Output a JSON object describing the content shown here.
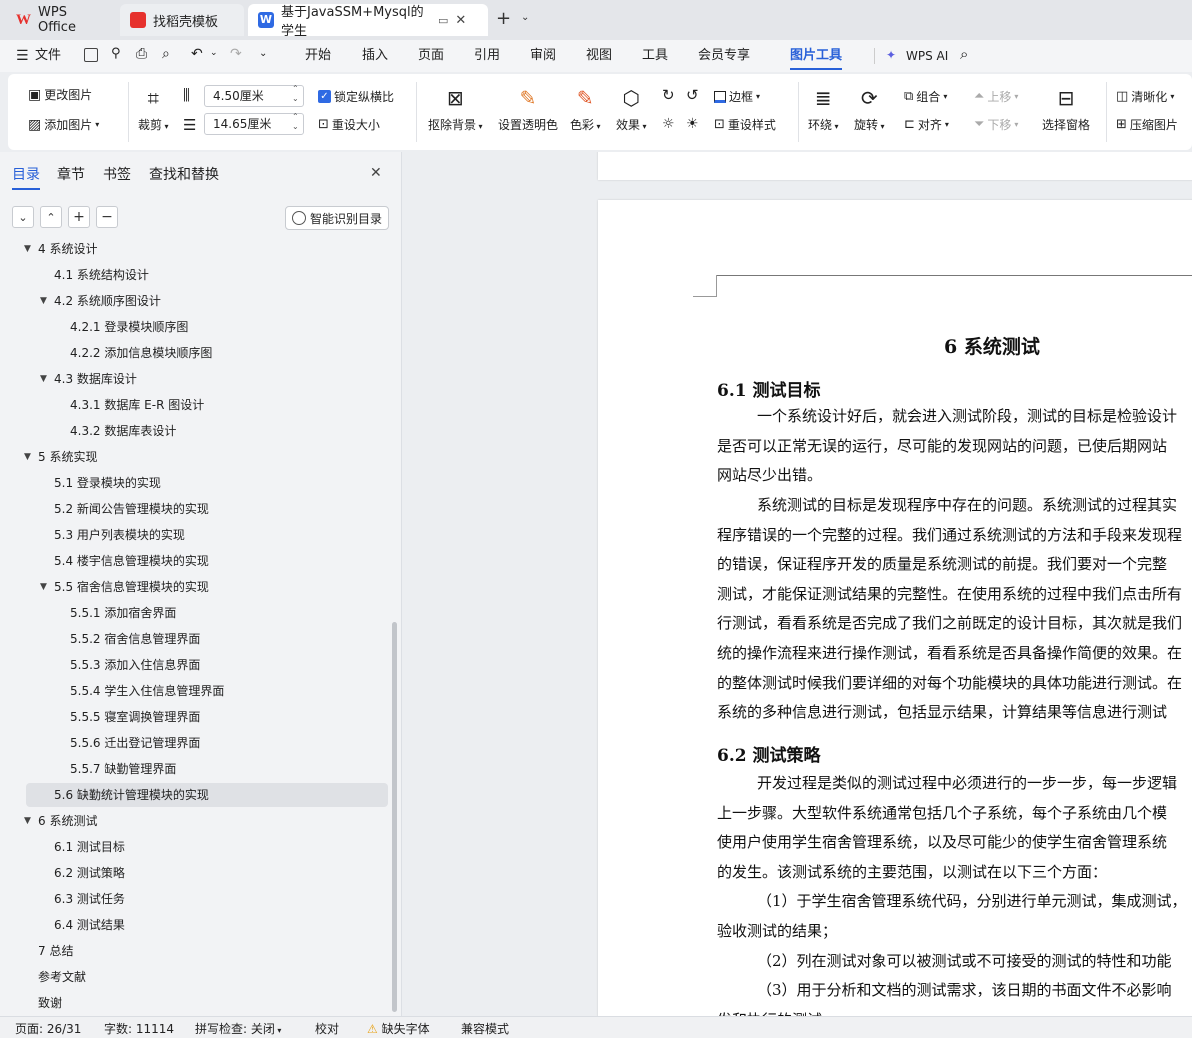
{
  "tabs": [
    {
      "label": "WPS Office"
    },
    {
      "label": "找稻壳模板"
    },
    {
      "label": "基于JavaSSM+Mysql的学生"
    }
  ],
  "menu": {
    "file": "文件",
    "items": [
      "开始",
      "插入",
      "页面",
      "引用",
      "审阅",
      "视图",
      "工具",
      "会员专享",
      "图片工具"
    ],
    "wps_ai": "WPS AI"
  },
  "ribbon": {
    "change_picture": "更改图片",
    "add_picture": "添加图片",
    "crop": "裁剪",
    "width_value": "4.50厘米",
    "height_value": "14.65厘米",
    "lock_ratio": "锁定纵横比",
    "resize": "重设大小",
    "remove_bg": "抠除背景",
    "set_transparent": "设置透明色",
    "color": "色彩",
    "effects": "效果",
    "border": "边框",
    "reset_style": "重设样式",
    "wrap": "环绕",
    "rotate": "旋转",
    "group": "组合",
    "align": "对齐",
    "move_up": "上移",
    "move_down": "下移",
    "select_pane": "选择窗格",
    "clarity": "清晰化",
    "compress": "压缩图片"
  },
  "panel": {
    "tabs": [
      "目录",
      "章节",
      "书签",
      "查找和替换"
    ],
    "smart_toc": "智能识别目录",
    "toc": [
      {
        "label": "4  系统设计",
        "level": 0,
        "arrow": true
      },
      {
        "label": "4.1  系统结构设计",
        "level": 1,
        "arrow": false
      },
      {
        "label": "4.2  系统顺序图设计",
        "level": 1,
        "arrow": true
      },
      {
        "label": "4.2.1 登录模块顺序图",
        "level": 2,
        "arrow": false
      },
      {
        "label": "4.2.2 添加信息模块顺序图",
        "level": 2,
        "arrow": false
      },
      {
        "label": "4.3  数据库设计",
        "level": 1,
        "arrow": true
      },
      {
        "label": "4.3.1 数据库 E-R 图设计",
        "level": 2,
        "arrow": false
      },
      {
        "label": "4.3.2 数据库表设计",
        "level": 2,
        "arrow": false
      },
      {
        "label": "5  系统实现",
        "level": 0,
        "arrow": true
      },
      {
        "label": "5.1  登录模块的实现",
        "level": 1,
        "arrow": false
      },
      {
        "label": "5.2  新闻公告管理模块的实现",
        "level": 1,
        "arrow": false
      },
      {
        "label": "5.3  用户列表模块的实现",
        "level": 1,
        "arrow": false
      },
      {
        "label": "5.4  楼宇信息管理模块的实现",
        "level": 1,
        "arrow": false
      },
      {
        "label": "5.5  宿舍信息管理模块的实现",
        "level": 1,
        "arrow": true
      },
      {
        "label": "5.5.1 添加宿舍界面",
        "level": 2,
        "arrow": false
      },
      {
        "label": "5.5.2 宿舍信息管理界面",
        "level": 2,
        "arrow": false
      },
      {
        "label": "5.5.3 添加入住信息界面",
        "level": 2,
        "arrow": false
      },
      {
        "label": "5.5.4 学生入住信息管理界面",
        "level": 2,
        "arrow": false
      },
      {
        "label": "5.5.5 寝室调换管理界面",
        "level": 2,
        "arrow": false
      },
      {
        "label": "5.5.6 迁出登记管理界面",
        "level": 2,
        "arrow": false
      },
      {
        "label": "5.5.7 缺勤管理界面",
        "level": 2,
        "arrow": false
      },
      {
        "label": "5.6  缺勤统计管理模块的实现",
        "level": 1,
        "arrow": false,
        "selected": true
      },
      {
        "label": "6  系统测试",
        "level": 0,
        "arrow": true
      },
      {
        "label": "6.1  测试目标",
        "level": 1,
        "arrow": false
      },
      {
        "label": "6.2  测试策略",
        "level": 1,
        "arrow": false
      },
      {
        "label": "6.3  测试任务",
        "level": 1,
        "arrow": false
      },
      {
        "label": "6.4  测试结果",
        "level": 1,
        "arrow": false
      },
      {
        "label": "7  总结",
        "level": 0,
        "arrow": false
      },
      {
        "label": "参考文献",
        "level": 0,
        "arrow": false
      },
      {
        "label": "致谢",
        "level": 0,
        "arrow": false
      }
    ]
  },
  "document": {
    "chapter_title": "6  系统测试",
    "h1": "6.1  测试目标",
    "p1": [
      "一个系统设计好后，就会进入测试阶段，测试的目标是检验设计",
      "是否可以正常无误的运行，尽可能的发现网站的问题，已使后期网站",
      "网站尽少出错。"
    ],
    "p2": [
      "系统测试的目标是发现程序中存在的问题。系统测试的过程其实",
      "程序错误的一个完整的过程。我们通过系统测试的方法和手段来发现程",
      "的错误，保证程序开发的质量是系统测试的前提。我们要对一个完整",
      "测试，才能保证测试结果的完整性。在使用系统的过程中我们点击所有",
      "行测试，看看系统是否完成了我们之前既定的设计目标，其次就是我们",
      "统的操作流程来进行操作测试，看看系统是否具备操作简便的效果。在",
      "的整体测试时候我们要详细的对每个功能模块的具体功能进行测试。在",
      "系统的多种信息进行测试，包括显示结果，计算结果等信息进行测试"
    ],
    "h2": "6.2  测试策略",
    "p3": [
      "开发过程是类似的测试过程中必须进行的一步一步，每一步逻辑",
      "上一步骤。大型软件系统通常包括几个子系统，每个子系统由几个模",
      "使用户使用学生宿舍管理系统，以及尽可能少的使学生宿舍管理系统",
      "的发生。该测试系统的主要范围，以测试在以下三个方面："
    ],
    "p4": [
      "（1）于学生宿舍管理系统代码，分别进行单元测试，集成测试，",
      "验收测试的结果；"
    ],
    "p5": "（2）列在测试对象可以被测试或不可接受的测试的特性和功能",
    "p6": [
      "（3）用于分析和文档的测试需求，该日期的书面文件不必影响",
      "发和执行的测试。"
    ]
  },
  "status": {
    "page": "页面: 26/31",
    "words": "字数: 11114",
    "spell": "拼写检查: 关闭",
    "proof": "校对",
    "missing_font": "缺失字体",
    "compat": "兼容模式"
  },
  "colors": {
    "accent": "#2860d8",
    "wps_red": "#e6312d",
    "word_blue": "#2f6ae3"
  }
}
